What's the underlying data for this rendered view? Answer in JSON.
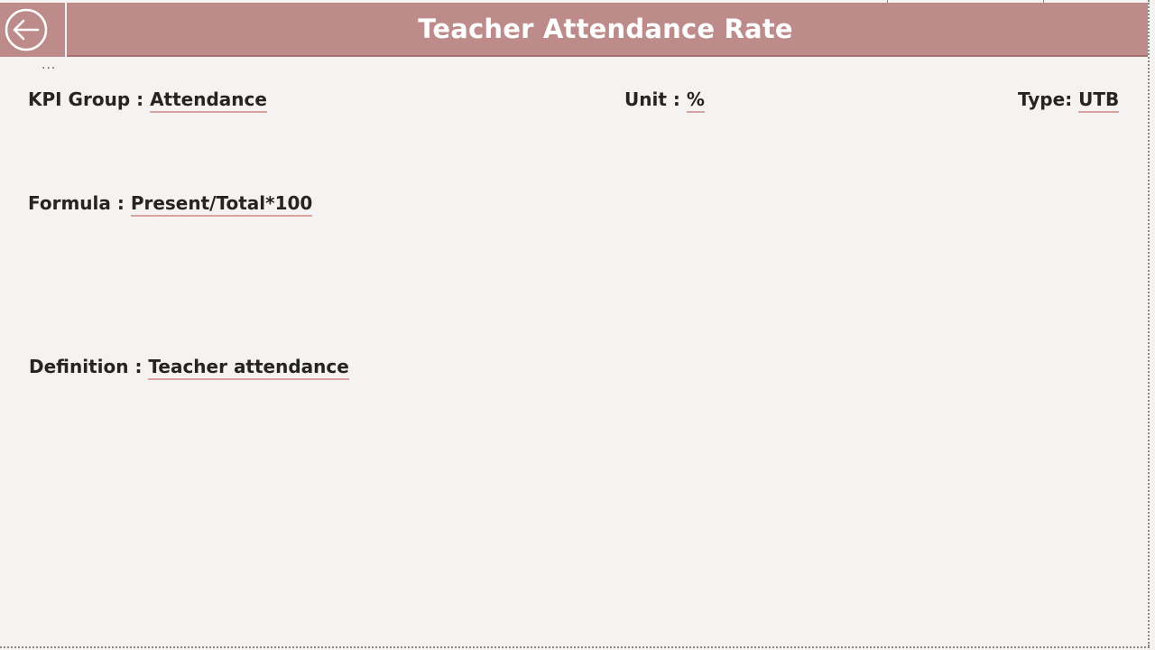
{
  "header": {
    "title": "Teacher Attendance Rate",
    "back_icon": "arrow-left-circle-icon",
    "more_options": "..."
  },
  "fields": {
    "kpi_group": {
      "label": "KPI Group : ",
      "value": "Attendance"
    },
    "unit": {
      "label": "Unit : ",
      "value": "%"
    },
    "type": {
      "label": "Type: ",
      "value": "UTB"
    },
    "formula": {
      "label": "Formula : ",
      "value": "Present/Total*100"
    },
    "definition": {
      "label": "Definition : ",
      "value": "Teacher attendance"
    }
  },
  "colors": {
    "header_bg": "#bc8b8a",
    "header_text": "#ffffff",
    "page_bg": "#f4f3f1",
    "value_underline": "#d8a3a2"
  }
}
